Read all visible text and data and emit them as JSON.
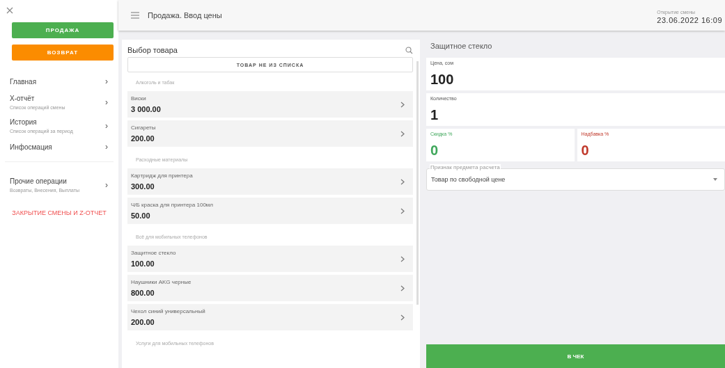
{
  "sidebar": {
    "sale_button": "ПРОДАЖА",
    "return_button": "ВОЗВРАТ",
    "items": [
      {
        "label": "Главная",
        "chevron": "›"
      },
      {
        "label": "Х-отчёт",
        "subtitle": "Список операций смены",
        "chevron": "›"
      },
      {
        "label": "История",
        "subtitle": "Список операций за период",
        "chevron": "›"
      },
      {
        "label": "Инфосмация",
        "chevron": "›"
      }
    ],
    "other": {
      "label": "Прочие операции",
      "subtitle": "Возвраты, Внесения, Выплаты",
      "chevron": "›"
    },
    "close_shift": "ЗАКРЫТИЕ СМЕНЫ И Z-ОТЧЕТ"
  },
  "header": {
    "title": "Продажа. Ввод цены",
    "shift_label": "Открытие смены",
    "shift_time": "23.06.2022 16:09"
  },
  "products": {
    "title": "Выбор товара",
    "custom_button": "ТОВАР НЕ ИЗ СПИСКА",
    "groups": [
      {
        "label": "Алкоголь и табак",
        "items": [
          {
            "name": "Виски",
            "price": "3 000.00"
          },
          {
            "name": "Сигареты",
            "price": "200.00"
          }
        ]
      },
      {
        "label": "Расходные материалы",
        "items": [
          {
            "name": "Картридж для принтера",
            "price": "300.00"
          },
          {
            "name": "Ч/Б краска для принтера 100мл",
            "price": "50.00"
          }
        ]
      },
      {
        "label": "Всё для мобильных телефонов",
        "items": [
          {
            "name": "Защитное стекло",
            "price": "100.00"
          },
          {
            "name": "Наушники AKG черные",
            "price": "800.00"
          },
          {
            "name": "Чехол синий универсальный",
            "price": "200.00"
          }
        ]
      },
      {
        "label": "Услуги для мобильных телефонов"
      }
    ]
  },
  "entry": {
    "title": "Защитное стекло",
    "price_label": "Цена, сом",
    "price": "100",
    "qty_label": "Количество",
    "qty": "1",
    "discount_label": "Скидка %",
    "discount": "0",
    "markup_label": "Надбавка %",
    "markup": "0",
    "select_label": "Признак предмета расчета",
    "select_value": "Товар по свободной цене",
    "submit": "В ЧЕК"
  }
}
